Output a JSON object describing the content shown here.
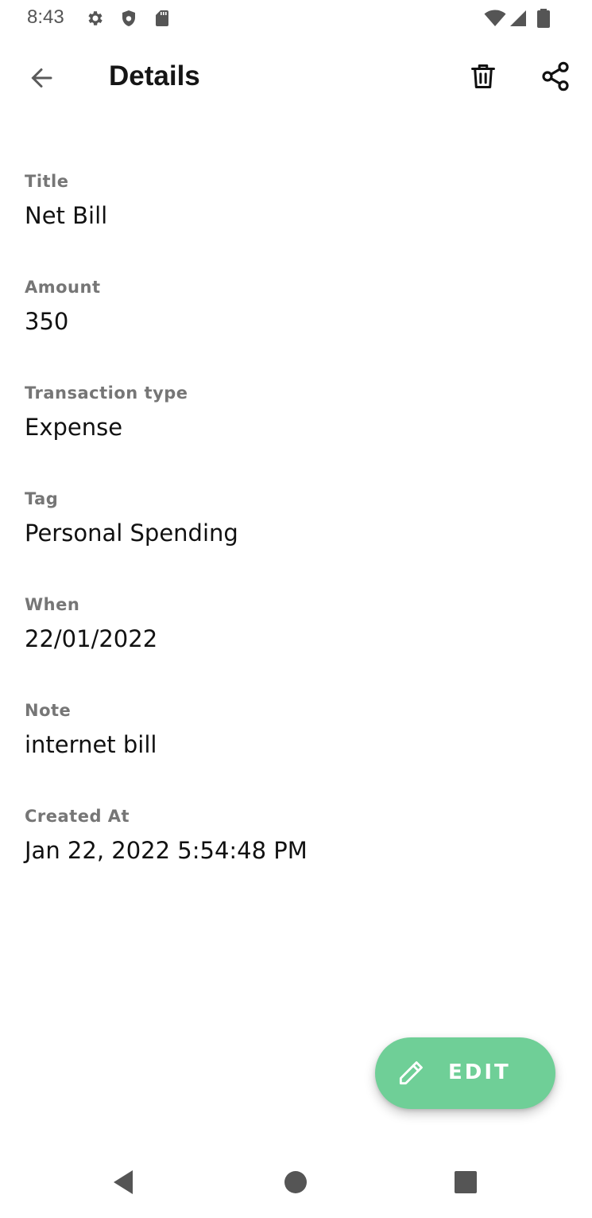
{
  "status_bar": {
    "time": "8:43",
    "left_icons": [
      "gear-icon",
      "shield-icon",
      "sd-card-icon"
    ],
    "right_icons": [
      "wifi-icon",
      "cellular-signal-icon",
      "battery-icon"
    ]
  },
  "app_bar": {
    "title": "Details",
    "back_icon": "arrow-back-icon",
    "actions": [
      "trash-icon",
      "share-icon"
    ]
  },
  "fields": [
    {
      "label": "Title",
      "value": "Net Bill"
    },
    {
      "label": "Amount",
      "value": "350"
    },
    {
      "label": "Transaction type",
      "value": "Expense"
    },
    {
      "label": "Tag",
      "value": "Personal Spending"
    },
    {
      "label": "When",
      "value": "22/01/2022"
    },
    {
      "label": "Note",
      "value": "internet bill"
    },
    {
      "label": "Created At",
      "value": "Jan 22, 2022 5:54:48 PM"
    }
  ],
  "fab": {
    "label": "EDIT",
    "icon": "pencil-icon",
    "color": "#6fcf97"
  },
  "nav_bar": {
    "buttons": [
      "back-triangle-icon",
      "home-circle-icon",
      "recents-square-icon"
    ]
  }
}
